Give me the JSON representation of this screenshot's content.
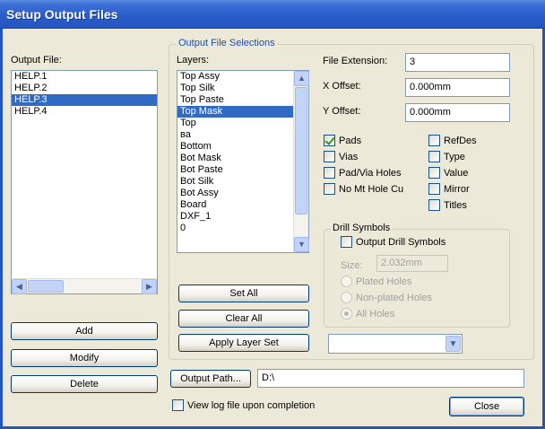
{
  "window": {
    "title": "Setup Output Files"
  },
  "output_files": {
    "label": "Output File:",
    "items": [
      "HELP.1",
      "HELP.2",
      "HELP.3",
      "HELP.4"
    ],
    "selected": "HELP.3"
  },
  "buttons": {
    "add": "Add",
    "modify": "Modify",
    "delete": "Delete",
    "set_all": "Set All",
    "clear_all": "Clear All",
    "apply_layer_set": "Apply Layer Set",
    "output_path": "Output Path...",
    "close": "Close"
  },
  "output_file_selections": {
    "group_label": "Output File Selections",
    "layers_label": "Layers:",
    "layers": [
      "Top Assy",
      "Top Silk",
      "Top Paste",
      "Top Mask",
      "Top",
      "ва",
      "Bottom",
      "Bot Mask",
      "Bot Paste",
      "Bot Silk",
      "Bot Assy",
      "Board",
      "DXF_1",
      "0"
    ],
    "selected_layer": "Top Mask"
  },
  "fields": {
    "file_extension_label": "File Extension:",
    "file_extension_value": "3",
    "x_offset_label": "X Offset:",
    "x_offset_value": "0.000mm",
    "y_offset_label": "Y Offset:",
    "y_offset_value": "0.000mm"
  },
  "checkboxes_left": [
    {
      "label": "Pads",
      "checked": true
    },
    {
      "label": "Vias",
      "checked": false
    },
    {
      "label": "Pad/Via Holes",
      "checked": false
    },
    {
      "label": "No Mt Hole Cu",
      "checked": false
    }
  ],
  "checkboxes_right": [
    {
      "label": "RefDes",
      "checked": false
    },
    {
      "label": "Type",
      "checked": false
    },
    {
      "label": "Value",
      "checked": false
    },
    {
      "label": "Mirror",
      "checked": false
    },
    {
      "label": "Titles",
      "checked": false
    }
  ],
  "drill_symbols": {
    "group_label": "Drill Symbols",
    "output_label": "Output Drill Symbols",
    "output_checked": false,
    "size_label": "Size:",
    "size_value": "2.032mm",
    "radios": [
      {
        "label": "Plated Holes",
        "selected": false
      },
      {
        "label": "Non-plated Holes",
        "selected": false
      },
      {
        "label": "All Holes",
        "selected": true
      }
    ]
  },
  "layer_set_combo": {
    "value": ""
  },
  "output_path": {
    "value": "D:\\"
  },
  "view_log": {
    "label": "View log file upon completion",
    "checked": false
  },
  "icons": {
    "scroll_up": "▲",
    "scroll_down": "▼",
    "scroll_left": "◀",
    "scroll_right": "▶",
    "dropdown": "▼"
  },
  "colors": {
    "titlebar": "#2356c2",
    "selection": "#316ac5",
    "dialog_bg": "#ece9d8"
  }
}
